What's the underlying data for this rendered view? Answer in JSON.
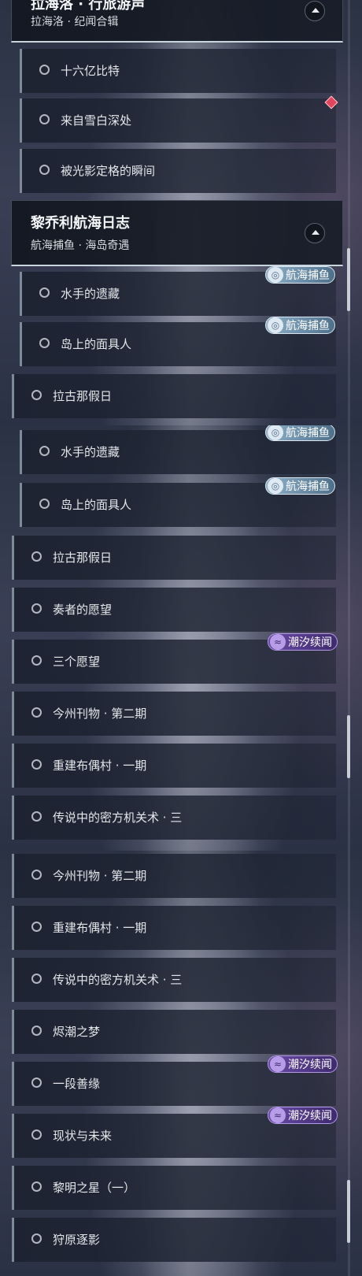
{
  "panel1": {
    "header_top": {
      "title": "拉海洛 · 行旅游声",
      "subtitle": "拉海洛 · 纪闻合辑"
    },
    "items_top": [
      "十六亿比特",
      "来自雪白深处",
      "被光影定格的瞬间"
    ],
    "header_mid": {
      "title": "黎乔利航海日志",
      "subtitle": "航海捕鱼 · 海岛奇遇"
    },
    "items_mid": [
      "水手的遗藏",
      "岛上的面具人"
    ],
    "items_main": [
      "拉古那假日"
    ]
  },
  "panel2": {
    "items_sub": [
      "水手的遗藏",
      "岛上的面具人"
    ],
    "items_main": [
      "拉古那假日",
      "奏者的愿望",
      "三个愿望",
      "今州刊物 · 第二期",
      "重建布偶村 · 一期",
      "传说中的密方机关术 · 三"
    ]
  },
  "panel3": {
    "items_main": [
      "今州刊物 · 第二期",
      "重建布偶村 · 一期",
      "传说中的密方机关术 · 三",
      "烬潮之梦",
      "一段善缘",
      "现状与未来",
      "黎明之星（一）",
      "狩原逐影"
    ]
  },
  "badges": {
    "fishing": "航海捕鱼",
    "tide": "潮汐续闻",
    "fishing_icon": "fish-icon",
    "tide_icon": "wave-icon"
  },
  "colors": {
    "fishing_badge": "#6f92ad",
    "tide_badge": "#5a3d96",
    "new_marker": "#e0475e"
  }
}
